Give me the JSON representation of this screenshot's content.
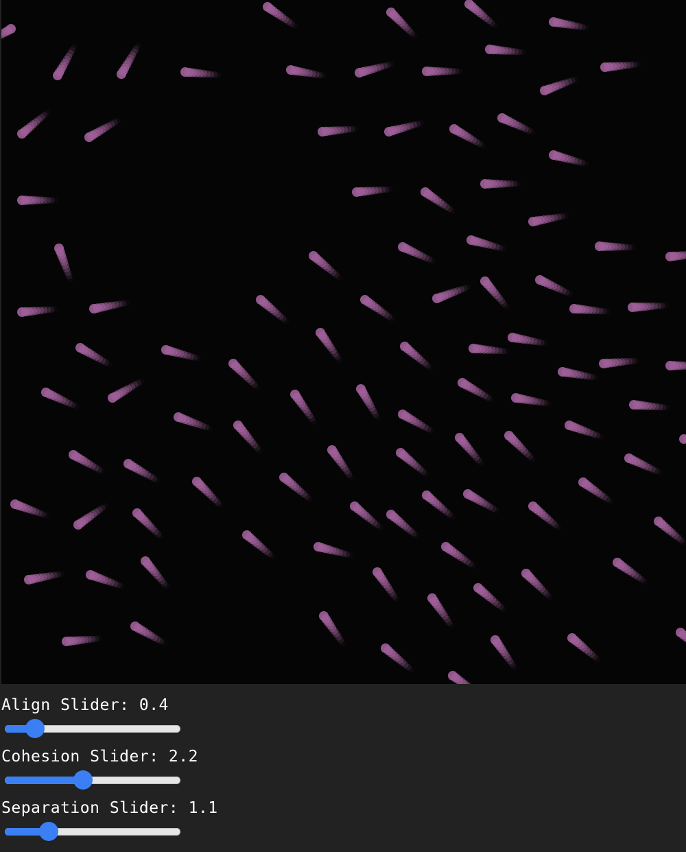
{
  "simulation": {
    "background": "#050505",
    "boid_color": "#a0609a"
  },
  "controls": {
    "align": {
      "label": "Align Slider: 0.4",
      "value": 0.4,
      "min": 0,
      "max": 3
    },
    "cohesion": {
      "label": "Cohesion Slider: 2.2",
      "value": 2.2,
      "min": 0,
      "max": 5
    },
    "separation": {
      "label": "Separation Slider: 1.1",
      "value": 1.1,
      "min": 0,
      "max": 5
    },
    "accent_color": "#3b7ff5"
  }
}
